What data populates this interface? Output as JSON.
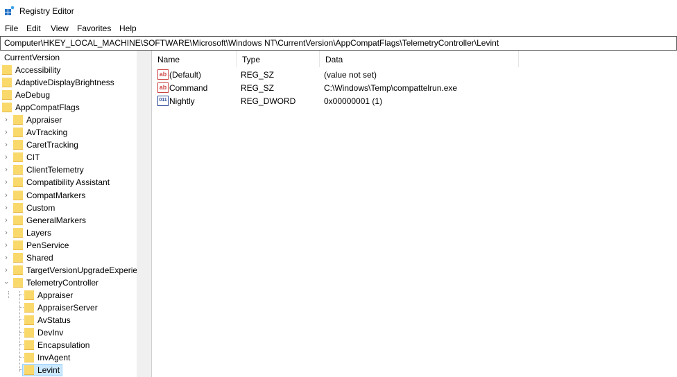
{
  "window": {
    "title": "Registry Editor"
  },
  "menu": [
    "File",
    "Edit",
    "View",
    "Favorites",
    "Help"
  ],
  "address": "Computer\\HKEY_LOCAL_MACHINE\\SOFTWARE\\Microsoft\\Windows NT\\CurrentVersion\\AppCompatFlags\\TelemetryController\\Levint",
  "tree": {
    "items": [
      {
        "label": "CurrentVersion"
      },
      {
        "label": "Accessibility"
      },
      {
        "label": "AdaptiveDisplayBrightness"
      },
      {
        "label": "AeDebug"
      },
      {
        "label": "AppCompatFlags"
      },
      {
        "label": "Appraiser"
      },
      {
        "label": "AvTracking"
      },
      {
        "label": "CaretTracking"
      },
      {
        "label": "CIT"
      },
      {
        "label": "ClientTelemetry"
      },
      {
        "label": "Compatibility Assistant"
      },
      {
        "label": "CompatMarkers"
      },
      {
        "label": "Custom"
      },
      {
        "label": "GeneralMarkers"
      },
      {
        "label": "Layers"
      },
      {
        "label": "PenService"
      },
      {
        "label": "Shared"
      },
      {
        "label": "TargetVersionUpgradeExperien"
      },
      {
        "label": "TelemetryController"
      },
      {
        "label": "Appraiser"
      },
      {
        "label": "AppraiserServer"
      },
      {
        "label": "AvStatus"
      },
      {
        "label": "DevInv"
      },
      {
        "label": "Encapsulation"
      },
      {
        "label": "InvAgent"
      },
      {
        "label": "Levint"
      }
    ]
  },
  "list": {
    "columns": [
      "Name",
      "Type",
      "Data"
    ],
    "rows": [
      {
        "name": "(Default)",
        "type": "REG_SZ",
        "data": "(value not set)",
        "icon": "ab"
      },
      {
        "name": "Command",
        "type": "REG_SZ",
        "data": "C:\\Windows\\Temp\\compattelrun.exe",
        "icon": "ab"
      },
      {
        "name": "Nightly",
        "type": "REG_DWORD",
        "data": "0x00000001 (1)",
        "icon": "011"
      }
    ]
  }
}
